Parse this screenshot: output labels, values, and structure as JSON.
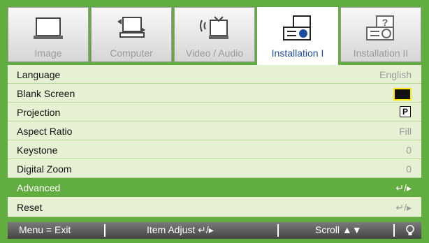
{
  "tabs": [
    {
      "label": "Image",
      "icon": "monitor-icon",
      "active": false
    },
    {
      "label": "Computer",
      "icon": "computer-icon",
      "active": false
    },
    {
      "label": "Video / Audio",
      "icon": "tv-signal-icon",
      "active": false
    },
    {
      "label": "Installation I",
      "icon": "projector-icon",
      "active": true
    },
    {
      "label": "Installation II",
      "icon": "projector-info-icon",
      "active": false
    }
  ],
  "menu": [
    {
      "label": "Language",
      "value": "English"
    },
    {
      "label": "Blank Screen",
      "value": "black-swatch"
    },
    {
      "label": "Projection",
      "value": "P"
    },
    {
      "label": "Aspect Ratio",
      "value": "Fill"
    },
    {
      "label": "Keystone",
      "value": "0"
    },
    {
      "label": "Digital Zoom",
      "value": "0"
    },
    {
      "label": "Advanced",
      "value": "↵/▸",
      "selected": true
    },
    {
      "label": "Reset",
      "value": "↵/▸"
    }
  ],
  "footer": {
    "exit": "Menu = Exit",
    "adjust": "Item Adjust ↵/▸",
    "scroll": "Scroll ▲▼",
    "bulb_icon": "lamp-icon"
  },
  "colors": {
    "accent": "#62ad3f",
    "panel": "#e6f1d4",
    "active_tab_text": "#1a4da0",
    "blank_swatch_border": "#ffe600"
  }
}
